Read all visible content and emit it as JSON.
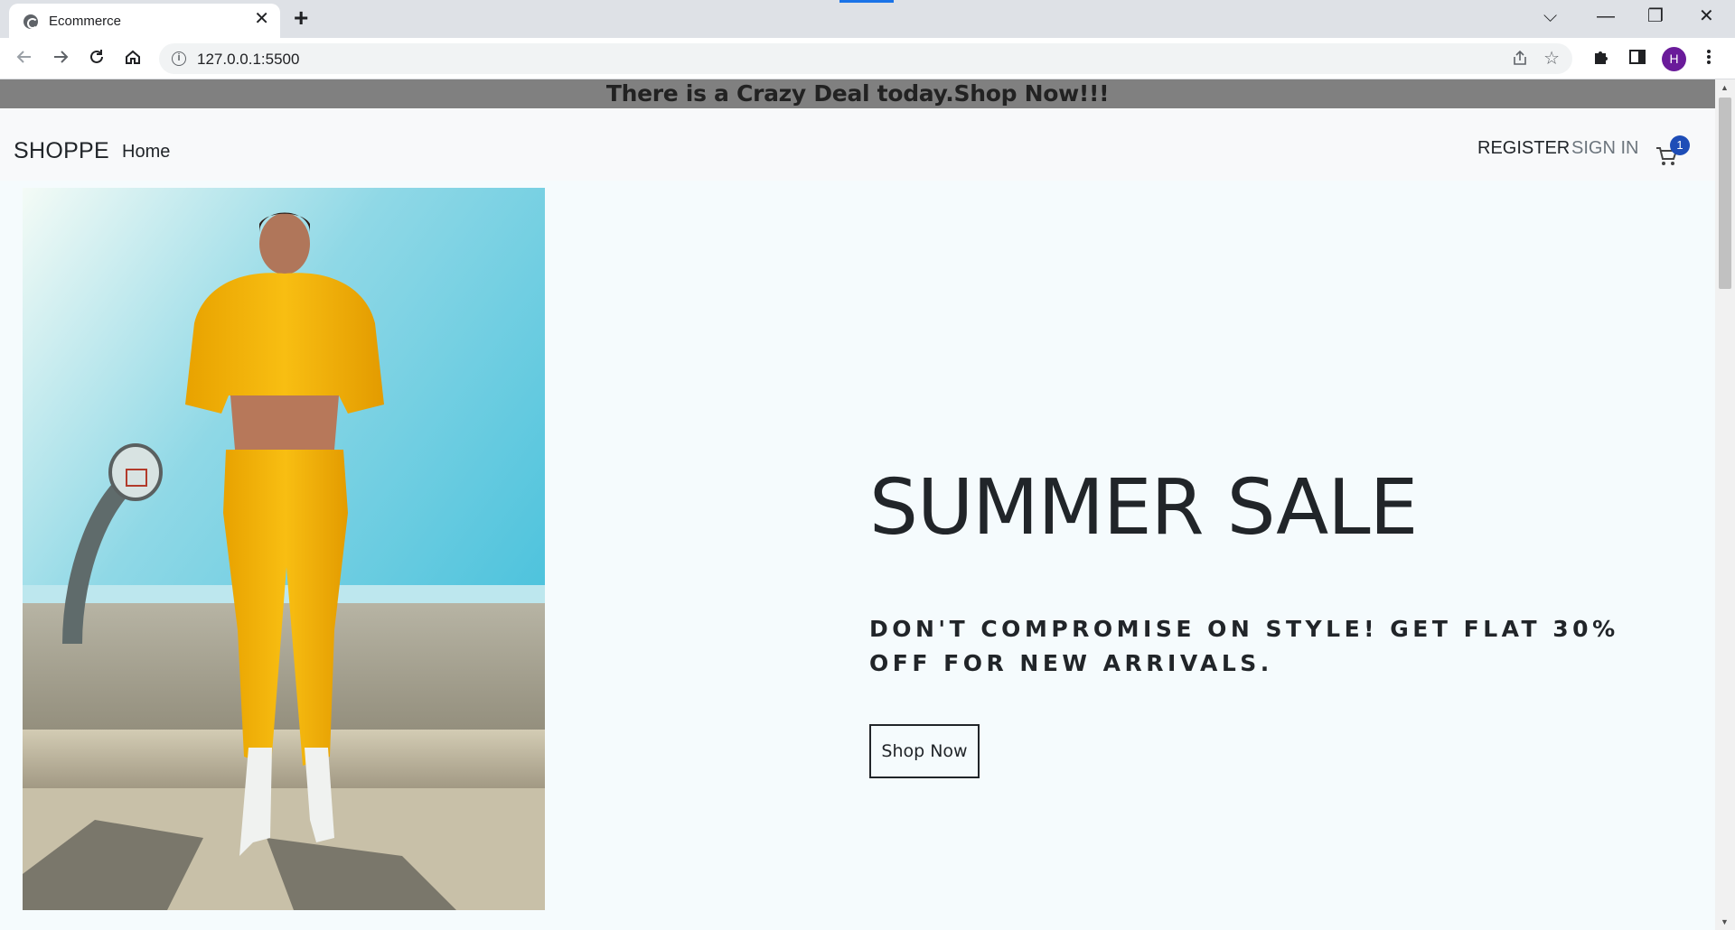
{
  "browser": {
    "tab_title": "Ecommerce",
    "tab_close": "✕",
    "new_tab": "+",
    "url": "127.0.0.1:5500",
    "profile_initial": "H",
    "window_controls": {
      "tabs_menu": "⌵",
      "minimize": "—",
      "restore": "❐",
      "close": "✕"
    },
    "icons": {
      "back": "arrow-left-icon",
      "forward": "arrow-right-icon",
      "reload": "reload-icon",
      "home": "home-icon",
      "share": "share-icon",
      "bookmark": "star-icon",
      "extensions": "puzzle-icon",
      "sidepanel": "sidepanel-icon",
      "menu": "kebab-menu-icon"
    }
  },
  "announcement": {
    "text": "There is a Crazy Deal today.Shop Now!!!"
  },
  "navbar": {
    "brand": "SHOPPE",
    "links": [
      {
        "label": "Home"
      }
    ],
    "register": "REGISTER",
    "sign_in": "SIGN IN",
    "cart_count": "1"
  },
  "hero": {
    "title": "SUMMER SALE",
    "description": "DON'T COMPROMISE ON STYLE! GET FLAT 30% OFF FOR NEW ARRIVALS.",
    "button": "Shop Now"
  },
  "colors": {
    "announcement_bg": "#808080",
    "page_bg": "#f5fbfd",
    "navbar_bg": "#f8f9fa",
    "badge": "#1e4db7",
    "profile": "#6a1b9a"
  }
}
